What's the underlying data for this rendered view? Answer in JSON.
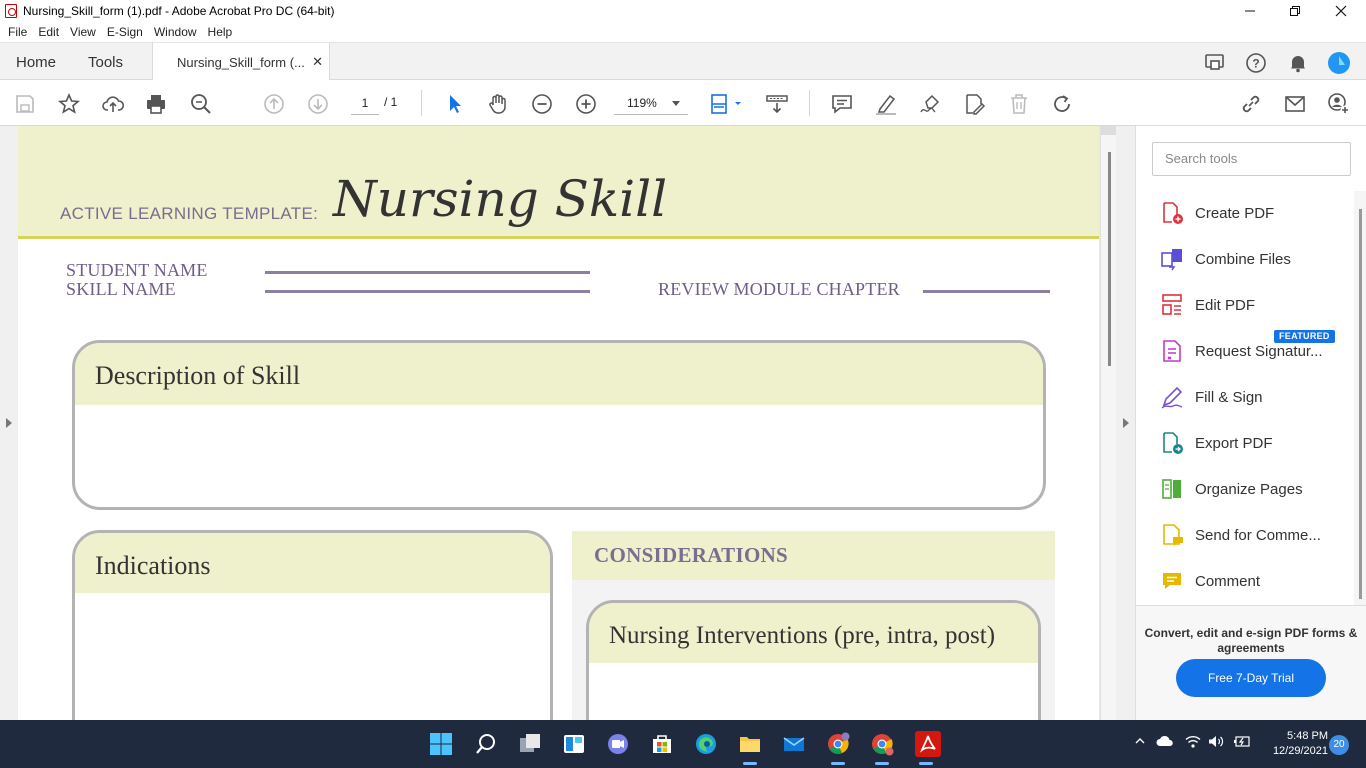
{
  "window": {
    "title": "Nursing_Skill_form (1).pdf - Adobe Acrobat Pro DC (64-bit)"
  },
  "menu": [
    "File",
    "Edit",
    "View",
    "E-Sign",
    "Window",
    "Help"
  ],
  "tabs": {
    "home": "Home",
    "tools": "Tools",
    "document": "Nursing_Skill_form (..."
  },
  "toolbar": {
    "page_current": "1",
    "page_total": "/ 1",
    "zoom": "119%"
  },
  "document": {
    "template_label": "ACTIVE LEARNING TEMPLATE:",
    "template_title": "Nursing Skill",
    "student_name_label": "STUDENT NAME",
    "skill_name_label": "SKILL NAME",
    "review_module_label": "REVIEW MODULE CHAPTER",
    "description_header": "Description of Skill",
    "indications_header": "Indications",
    "considerations_header": "CONSIDERATIONS",
    "interventions_header": "Nursing Interventions (pre, intra, post)"
  },
  "tools_panel": {
    "search_placeholder": "Search tools",
    "featured_badge": "FEATURED",
    "items": [
      {
        "label": "Create PDF",
        "icon": "create-pdf-icon",
        "color": "#e0323c"
      },
      {
        "label": "Combine Files",
        "icon": "combine-files-icon",
        "color": "#5b4fd8"
      },
      {
        "label": "Edit PDF",
        "icon": "edit-pdf-icon",
        "color": "#e0323c"
      },
      {
        "label": "Request Signatur...",
        "icon": "request-signature-icon",
        "color": "#c13cc9"
      },
      {
        "label": "Fill & Sign",
        "icon": "fill-sign-icon",
        "color": "#7a4fd8"
      },
      {
        "label": "Export PDF",
        "icon": "export-pdf-icon",
        "color": "#16878c"
      },
      {
        "label": "Organize Pages",
        "icon": "organize-pages-icon",
        "color": "#4caf3a"
      },
      {
        "label": "Send for Comme...",
        "icon": "send-for-comment-icon",
        "color": "#e6b800"
      },
      {
        "label": "Comment",
        "icon": "comment-icon",
        "color": "#e6b800"
      }
    ],
    "promo_text": "Convert, edit and e-sign PDF forms & agreements",
    "promo_button": "Free 7-Day Trial"
  },
  "taskbar": {
    "time": "5:48 PM",
    "date": "12/29/2021",
    "notification_count": "20"
  },
  "colors": {
    "accent_blue": "#1473e6",
    "template_green": "#eff0cc",
    "template_purple": "#7a6d8f"
  }
}
